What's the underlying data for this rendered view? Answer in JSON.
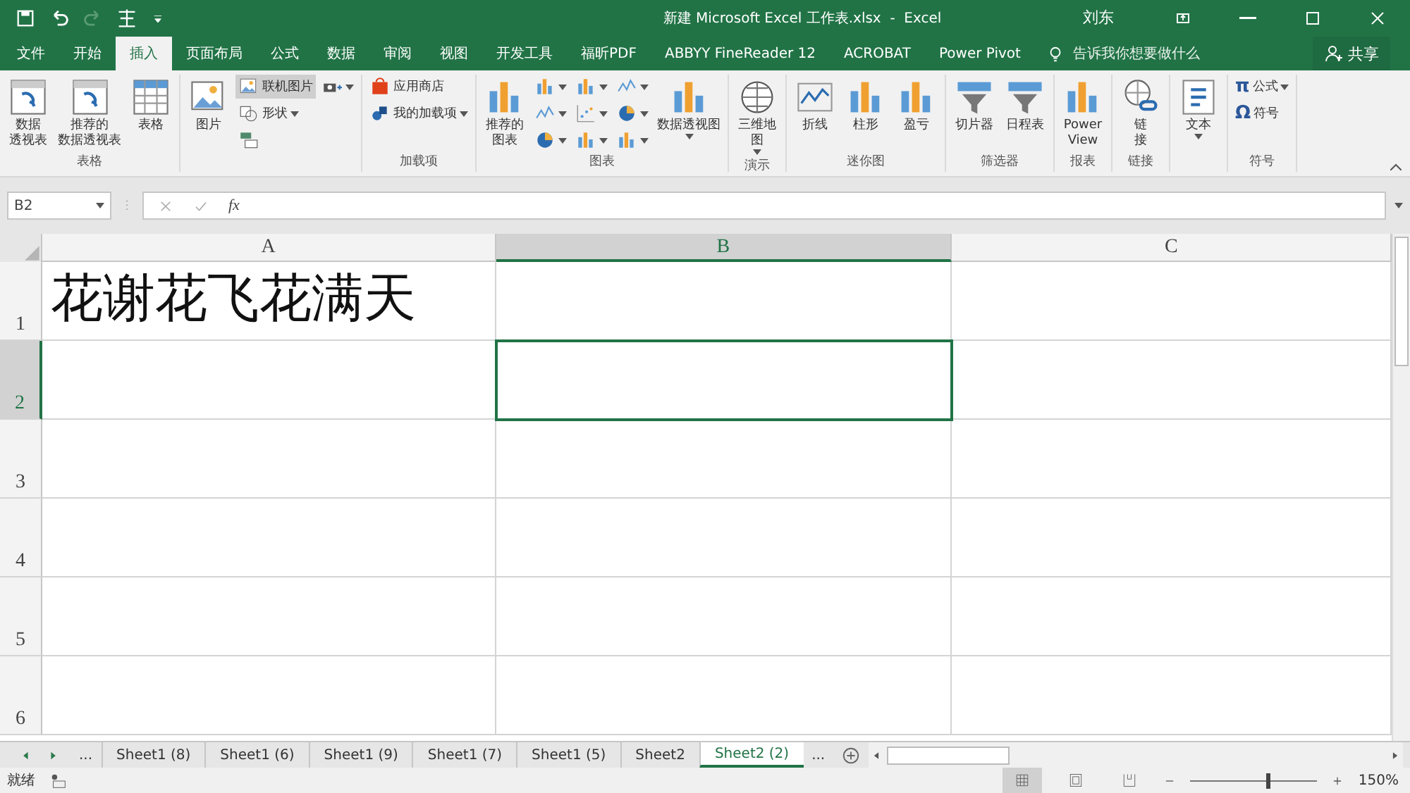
{
  "title_bar": {
    "title": "新建 Microsoft Excel 工作表.xlsx  -  Excel",
    "user": "刘东"
  },
  "tabs": [
    {
      "label": "文件",
      "selected": false
    },
    {
      "label": "开始",
      "selected": false
    },
    {
      "label": "插入",
      "selected": true
    },
    {
      "label": "页面布局",
      "selected": false
    },
    {
      "label": "公式",
      "selected": false
    },
    {
      "label": "数据",
      "selected": false
    },
    {
      "label": "审阅",
      "selected": false
    },
    {
      "label": "视图",
      "selected": false
    },
    {
      "label": "开发工具",
      "selected": false
    },
    {
      "label": "福昕PDF",
      "selected": false
    },
    {
      "label": "ABBYY FineReader 12",
      "selected": false
    },
    {
      "label": "ACROBAT",
      "selected": false
    },
    {
      "label": "Power Pivot",
      "selected": false
    }
  ],
  "tell_me": {
    "placeholder": "告诉我你想要做什么"
  },
  "share": "共享",
  "ribbon_groups": [
    {
      "label": "表格",
      "columns": [
        [
          {
            "kind": "large",
            "lines": [
              "数据",
              "透视表"
            ],
            "dropdown": false,
            "highlighted": false
          }
        ],
        [
          {
            "kind": "large",
            "lines": [
              "推荐的",
              "数据透视表"
            ],
            "dropdown": false,
            "highlighted": false
          }
        ],
        [
          {
            "kind": "large",
            "lines": [
              "表格"
            ],
            "dropdown": false,
            "highlighted": false
          }
        ]
      ]
    },
    {
      "columns": [
        [
          {
            "kind": "large",
            "lines": [
              "图片"
            ],
            "dropdown": false,
            "highlighted": false
          }
        ],
        [
          {
            "kind": "small",
            "label": "联机图片",
            "dropdown": false,
            "highlighted": true
          },
          {
            "kind": "small",
            "label": "形状",
            "dropdown": true,
            "highlighted": false
          },
          {
            "kind": "icon",
            "dropdown": false,
            "highlighted": false
          }
        ],
        [
          {
            "kind": "icon",
            "dropdown": true,
            "highlighted": false
          }
        ]
      ]
    },
    {
      "label": "加载项",
      "columns": [
        [
          {
            "kind": "small",
            "label": "应用商店",
            "dropdown": false,
            "highlighted": false
          },
          {
            "kind": "small",
            "label": "我的加载项",
            "dropdown": true,
            "highlighted": false
          }
        ]
      ]
    },
    {
      "label": "图表",
      "columns": [
        [
          {
            "kind": "large",
            "lines": [
              "推荐的",
              "图表"
            ],
            "dropdown": false,
            "highlighted": false
          }
        ],
        [
          {
            "kind": "icon",
            "dropdown": true,
            "highlighted": false
          },
          {
            "kind": "icon",
            "dropdown": true,
            "highlighted": false
          },
          {
            "kind": "icon",
            "dropdown": true,
            "highlighted": false
          }
        ],
        [
          {
            "kind": "icon",
            "dropdown": true,
            "highlighted": false
          },
          {
            "kind": "icon",
            "dropdown": true,
            "highlighted": false
          },
          {
            "kind": "icon",
            "dropdown": true,
            "highlighted": false
          }
        ],
        [
          {
            "kind": "icon",
            "dropdown": true,
            "highlighted": false
          },
          {
            "kind": "icon",
            "dropdown": true,
            "highlighted": false
          },
          {
            "kind": "icon",
            "dropdown": true,
            "highlighted": false
          }
        ],
        [
          {
            "kind": "large",
            "lines": [
              "数据透视图"
            ],
            "dropdown": true,
            "highlighted": false
          }
        ]
      ]
    },
    {
      "label": "演示",
      "columns": [
        [
          {
            "kind": "large",
            "lines": [
              "三维地",
              "图"
            ],
            "dropdown": true,
            "highlighted": false
          }
        ]
      ]
    },
    {
      "label": "迷你图",
      "columns": [
        [
          {
            "kind": "large",
            "lines": [
              "折线"
            ],
            "dropdown": false,
            "highlighted": false
          }
        ],
        [
          {
            "kind": "large",
            "lines": [
              "柱形"
            ],
            "dropdown": false,
            "highlighted": false
          }
        ],
        [
          {
            "kind": "large",
            "lines": [
              "盈亏"
            ],
            "dropdown": false,
            "highlighted": false
          }
        ]
      ]
    },
    {
      "label": "筛选器",
      "columns": [
        [
          {
            "kind": "large",
            "lines": [
              "切片器"
            ],
            "dropdown": false,
            "highlighted": false
          }
        ],
        [
          {
            "kind": "large",
            "lines": [
              "日程表"
            ],
            "dropdown": false,
            "highlighted": false
          }
        ]
      ]
    },
    {
      "label": "报表",
      "columns": [
        [
          {
            "kind": "large",
            "lines": [
              "Power",
              "View"
            ],
            "dropdown": false,
            "highlighted": false
          }
        ]
      ]
    },
    {
      "label": "链接",
      "columns": [
        [
          {
            "kind": "large",
            "lines": [
              "链",
              "接"
            ],
            "dropdown": false,
            "highlighted": false
          }
        ]
      ]
    },
    {
      "columns": [
        [
          {
            "kind": "large",
            "lines": [
              "文本"
            ],
            "dropdown": true,
            "highlighted": false
          }
        ]
      ]
    },
    {
      "label": "符号",
      "columns": [
        [
          {
            "kind": "glyph",
            "glyph": "π",
            "label": "公式",
            "dropdown": true,
            "highlighted": false
          },
          {
            "kind": "glyph",
            "glyph": "Ω",
            "label": "符号",
            "dropdown": false,
            "highlighted": false
          }
        ]
      ]
    }
  ],
  "formula_bar": {
    "name_box": "B2",
    "function_button": "fx"
  },
  "columns": [
    {
      "label": "A",
      "selected": false
    },
    {
      "label": "B",
      "selected": true
    },
    {
      "label": "C",
      "selected": false
    }
  ],
  "rows": [
    {
      "label": "1",
      "selected": false,
      "cells": [
        "花谢花飞花满天"
      ]
    },
    {
      "label": "2",
      "selected": true
    },
    {
      "label": "3",
      "selected": false
    },
    {
      "label": "4",
      "selected": false
    },
    {
      "label": "5",
      "selected": false
    },
    {
      "label": "6",
      "selected": false
    }
  ],
  "sheet_tabs": {
    "more_left": "...",
    "more_right": "...",
    "tabs": [
      {
        "label": "Sheet1 (8)",
        "selected": false
      },
      {
        "label": "Sheet1 (6)",
        "selected": false
      },
      {
        "label": "Sheet1 (9)",
        "selected": false
      },
      {
        "label": "Sheet1 (7)",
        "selected": false
      },
      {
        "label": "Sheet1 (5)",
        "selected": false
      },
      {
        "label": "Sheet2",
        "selected": false
      },
      {
        "label": "Sheet2 (2)",
        "selected": true
      }
    ]
  },
  "status_bar": {
    "status": "就绪",
    "views": [
      {
        "selected": true
      },
      {
        "selected": false
      },
      {
        "selected": false
      }
    ],
    "zoom": {
      "level": 0.6,
      "reading": "150%"
    }
  }
}
